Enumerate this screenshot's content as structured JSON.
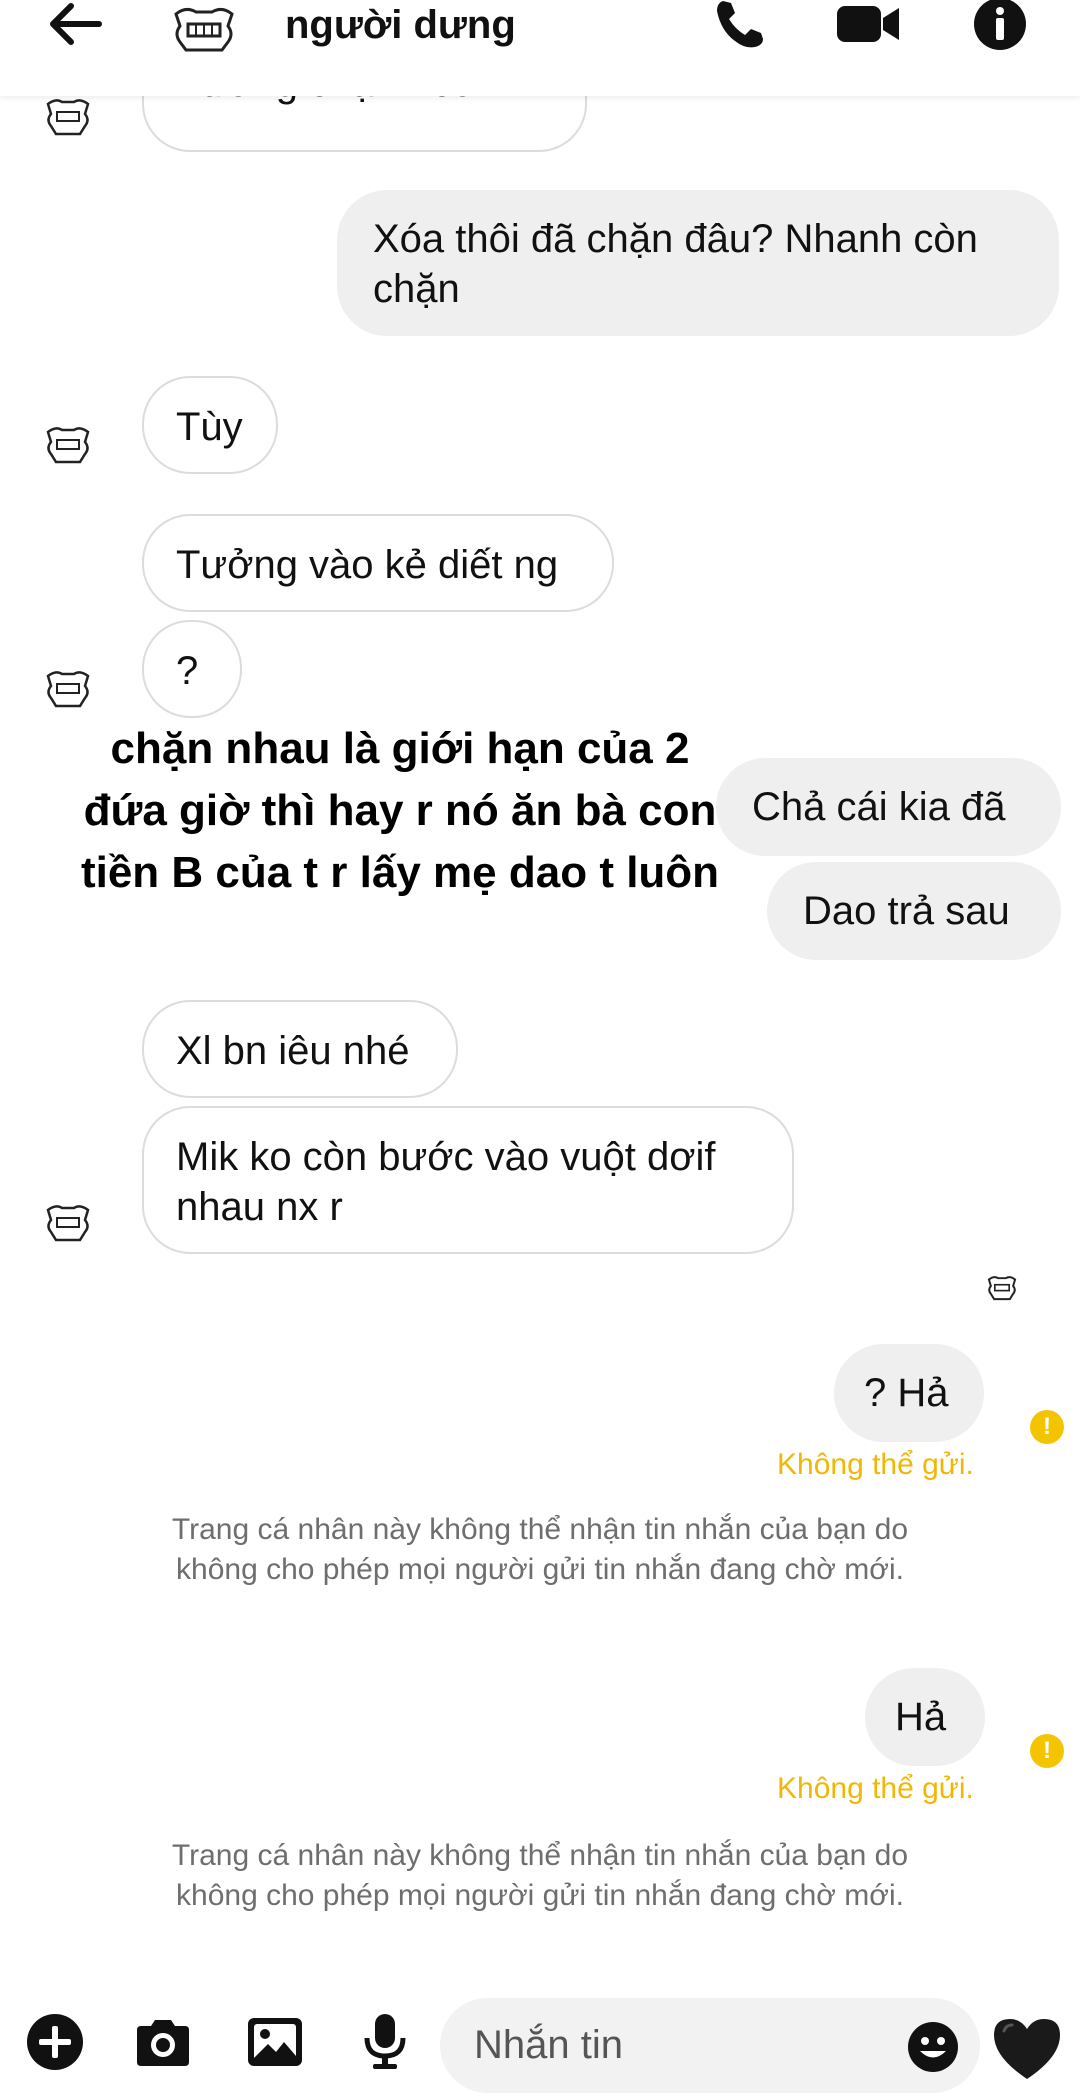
{
  "header": {
    "contact_name": "người dưng",
    "back_icon": "arrow-left-icon",
    "call_icon": "phone-icon",
    "video_icon": "video-camera-icon",
    "info_icon": "info-icon"
  },
  "messages": {
    "m0": "Tưởng chặn r cơ",
    "m1": "Xóa thôi đã chặn đâu? Nhanh còn chặn",
    "m2": "Tùy",
    "m3": "Tưởng vào kẻ diết ng",
    "m4": "?",
    "m5": "Chả cái kia đã",
    "m6": "Dao trả sau",
    "m7": "Xl bn iêu nhé",
    "m8": "Mik ko còn bước vào vuột dơif nhau nx r",
    "m9": "? Hả",
    "m10": "Hả"
  },
  "overlay_caption": "chặn nhau là giới hạn của 2 đứa giờ thì hay r nó ăn bà con tiền B của t r lấy mẹ dao t luôn",
  "failed_label": "Không thể gửi.",
  "notice_text": "Trang cá nhân này không thể nhận tin nhắn của bạn do không cho phép mọi người gửi tin nhắn đang chờ mới.",
  "composer": {
    "placeholder": "Nhắn tin",
    "icons": [
      "plus-icon",
      "camera-icon",
      "image-icon",
      "microphone-icon",
      "emoji-icon",
      "heart-icon"
    ]
  },
  "colors": {
    "warning": "#f5c400",
    "outgoing_bubble": "#efefef",
    "notice_text": "#6e6e6e"
  }
}
